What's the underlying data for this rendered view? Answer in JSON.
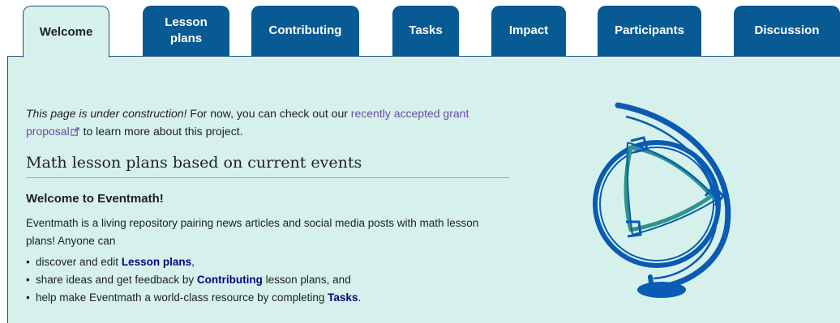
{
  "tabs": [
    {
      "label": "Welcome",
      "active": true
    },
    {
      "label": "Lesson plans",
      "active": false
    },
    {
      "label": "Contributing",
      "active": false
    },
    {
      "label": "Tasks",
      "active": false
    },
    {
      "label": "Impact",
      "active": false
    },
    {
      "label": "Participants",
      "active": false
    },
    {
      "label": "Discussion",
      "active": false
    }
  ],
  "intro": {
    "italic": "This page is under construction!",
    "text1": " For now, you can check out our ",
    "link": "recently accepted grant proposal",
    "text2": " to learn more about this project."
  },
  "heading": "Math lesson plans based on current events",
  "subheading": "Welcome to Eventmath!",
  "paragraph": "Eventmath is a living repository pairing news articles and social media posts with math lesson plans! Anyone can",
  "list": [
    {
      "pre": "discover and edit ",
      "link": "Lesson plans",
      "post": ","
    },
    {
      "pre": "share ideas and get feedback by ",
      "link": "Contributing",
      "post": " lesson plans, and"
    },
    {
      "pre": "help make Eventmath a world-class resource by completing ",
      "link": "Tasks",
      "post": "."
    }
  ],
  "colors": {
    "tab_bg": "#085a93",
    "panel_bg": "#d6f1ec",
    "globe_blue": "#0b5ab3",
    "globe_teal": "#2e9688",
    "link_visited": "#6b4ba1",
    "link_bold": "#0b0080"
  }
}
